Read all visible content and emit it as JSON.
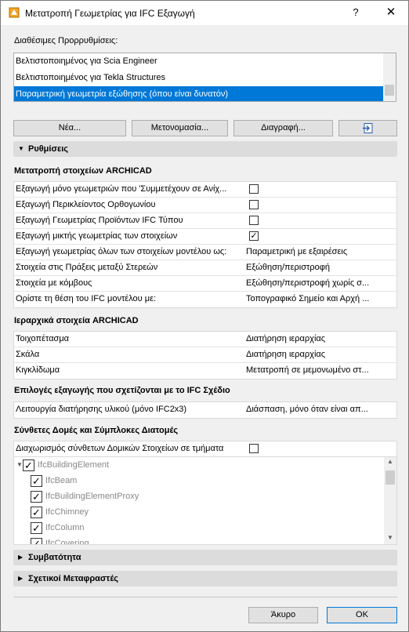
{
  "window": {
    "title": "Μετατροπή Γεωμετρίας για IFC Εξαγωγή",
    "help": "?",
    "close": "✕"
  },
  "presets": {
    "label": "Διαθέσιμες Προρρυθμίσεις:",
    "items": [
      "Βελτιστοποιημένος για Scia Engineer",
      "Βελτιστοποιημένος για Tekla Structures",
      "Παραμετρική γεωμετρία εξώθησης (όπου είναι δυνατόν)"
    ],
    "selected_index": 2
  },
  "buttons": {
    "new": "Νέα...",
    "rename": "Μετονομασία...",
    "delete": "Διαγραφή..."
  },
  "settings": {
    "header": "Ρυθμίσεις",
    "convert_group": {
      "title": "Μετατροπή στοιχείων ARCHICAD",
      "rows": [
        {
          "name": "Εξαγωγή μόνο γεωμετριών που 'Συμμετέχουν σε Ανίχ...",
          "checked": false
        },
        {
          "name": "Εξαγωγή Περικλείοντος Ορθογωνίου",
          "checked": false
        },
        {
          "name": "Εξαγωγή Γεωμετρίας Προϊόντων IFC Τύπου",
          "checked": false
        },
        {
          "name": "Εξαγωγή μικτής γεωμετρίας των στοιχείων",
          "checked": true
        },
        {
          "name": "Εξαγωγή γεωμετρίας όλων των στοιχείων μοντέλου ως:",
          "value": "Παραμετρική με εξαιρέσεις"
        },
        {
          "name": "Στοιχεία στις Πράξεις μεταξύ Στερεών",
          "value": "Εξώθηση/περιστροφή"
        },
        {
          "name": "Στοιχεία με κόμβους",
          "value": "Εξώθηση/περιστροφή χωρίς σ..."
        },
        {
          "name": "Ορίστε τη θέση του IFC μοντέλου με:",
          "value": "Τοπογραφικό Σημείο και Αρχή ..."
        }
      ]
    },
    "hierarchy_group": {
      "title": "Ιεραρχικά στοιχεία ARCHICAD",
      "rows": [
        {
          "name": "Τοιχοπέτασμα",
          "value": "Διατήρηση ιεραρχίας"
        },
        {
          "name": "Σκάλα",
          "value": "Διατήρηση ιεραρχίας"
        },
        {
          "name": "Κιγκλίδωμα",
          "value": "Μετατροπή σε μεμονωμένο στ..."
        }
      ]
    },
    "ifc_plan_group": {
      "title": "Επιλογές εξαγωγής που σχετίζονται με το IFC Σχέδιο",
      "rows": [
        {
          "name": "Λειτουργία διατήρησης υλικού (μόνο IFC2x3)",
          "value": "Διάσπαση, μόνο όταν είναι απ..."
        }
      ]
    },
    "composite_group": {
      "title": "Σύνθετες Δομές και Σύμπλοκες Διατομές",
      "split_label": "Διαχωρισμός σύνθετων Δομικών Στοιχείων σε τμήματα",
      "split_checked": false,
      "tree": [
        {
          "label": "IfcBuildingElement",
          "level": 0,
          "checked": true,
          "expanded": true
        },
        {
          "label": "IfcBeam",
          "level": 1,
          "checked": true
        },
        {
          "label": "IfcBuildingElementProxy",
          "level": 1,
          "checked": true
        },
        {
          "label": "IfcChimney",
          "level": 1,
          "checked": true
        },
        {
          "label": "IfcColumn",
          "level": 1,
          "checked": true
        },
        {
          "label": "IfcCovering",
          "level": 1,
          "checked": true
        }
      ]
    }
  },
  "collapsed_sections": {
    "compatibility": "Συμβατότητα",
    "translators": "Σχετικοί Μεταφραστές"
  },
  "footer": {
    "cancel": "Άκυρο",
    "ok": "OK"
  },
  "colors": {
    "selection": "#0078d7",
    "section_bg": "#dcdcdc"
  }
}
